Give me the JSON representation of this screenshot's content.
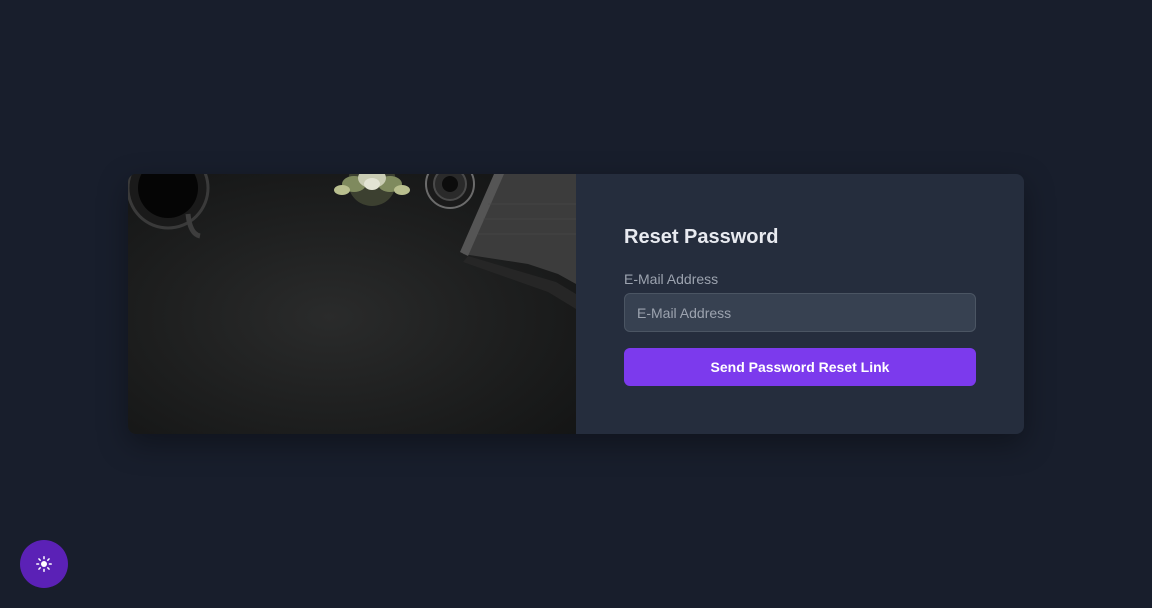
{
  "reset_form": {
    "title": "Reset Password",
    "email_label": "E-Mail Address",
    "email_placeholder": "E-Mail Address",
    "email_value": "",
    "submit_label": "Send Password Reset Link"
  },
  "theme_toggle": {
    "icon": "sun-icon"
  },
  "photo": {
    "icon": "desk-photo"
  },
  "colors": {
    "page_background": "#181e2c",
    "panel_background": "#252d3d",
    "input_background": "#374151",
    "accent": "#7c3aed",
    "toggle_background": "#5b21b6"
  }
}
